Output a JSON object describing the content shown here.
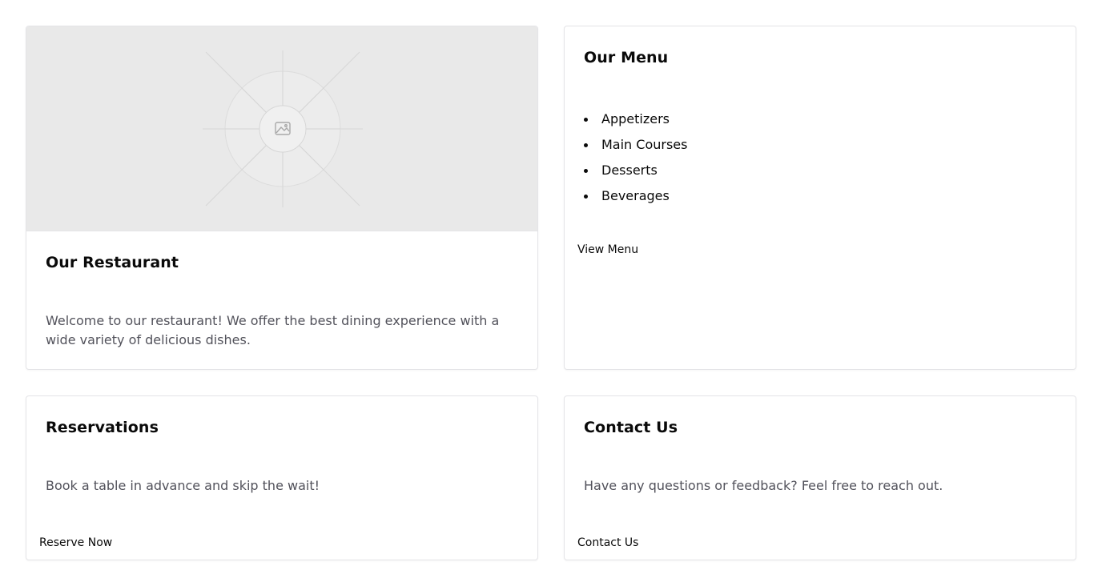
{
  "restaurant": {
    "title": "Our Restaurant",
    "description": "Welcome to our restaurant! We offer the best dining experience with a wide variety of delicious dishes.",
    "image_icon": "image-icon"
  },
  "menu": {
    "title": "Our Menu",
    "items": [
      {
        "label": "Appetizers"
      },
      {
        "label": "Main Courses"
      },
      {
        "label": "Desserts"
      },
      {
        "label": "Beverages"
      }
    ],
    "action_label": "View Menu"
  },
  "reservations": {
    "title": "Reservations",
    "description": "Book a table in advance and skip the wait!",
    "action_label": "Reserve Now"
  },
  "contact": {
    "title": "Contact Us",
    "description": "Have any questions or feedback? Feel free to reach out.",
    "action_label": "Contact Us"
  },
  "colors": {
    "text": "#0a0a0a",
    "muted_text": "#52525b",
    "border": "#e4e4e7",
    "placeholder_bg": "#e9e9e9"
  }
}
